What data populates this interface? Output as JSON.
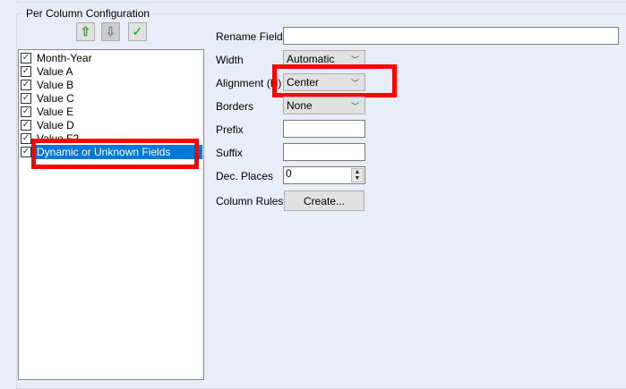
{
  "group_title": "Per Column Configuration",
  "toolbar": {
    "up": "⇧",
    "down": "⇩",
    "check": "✓"
  },
  "fields": [
    "Month-Year",
    "Value A",
    "Value B",
    "Value C",
    "Value E",
    "Value D",
    "Value F2",
    "Dynamic or Unknown Fields"
  ],
  "selected_field": "Dynamic or Unknown Fields",
  "form": {
    "rename_label": "Rename Field",
    "rename_value": "",
    "width_label": "Width",
    "width_value": "Automatic",
    "alignment_label": "Alignment (H)",
    "alignment_value": "Center",
    "borders_label": "Borders",
    "borders_value": "None",
    "prefix_label": "Prefix",
    "prefix_value": "",
    "suffix_label": "Suffix",
    "suffix_value": "",
    "dec_label": "Dec. Places",
    "dec_value": "0",
    "rules_label": "Column Rules",
    "create_button": "Create..."
  },
  "colors": {
    "highlight": "#ff0000",
    "selection": "#0078d7"
  }
}
